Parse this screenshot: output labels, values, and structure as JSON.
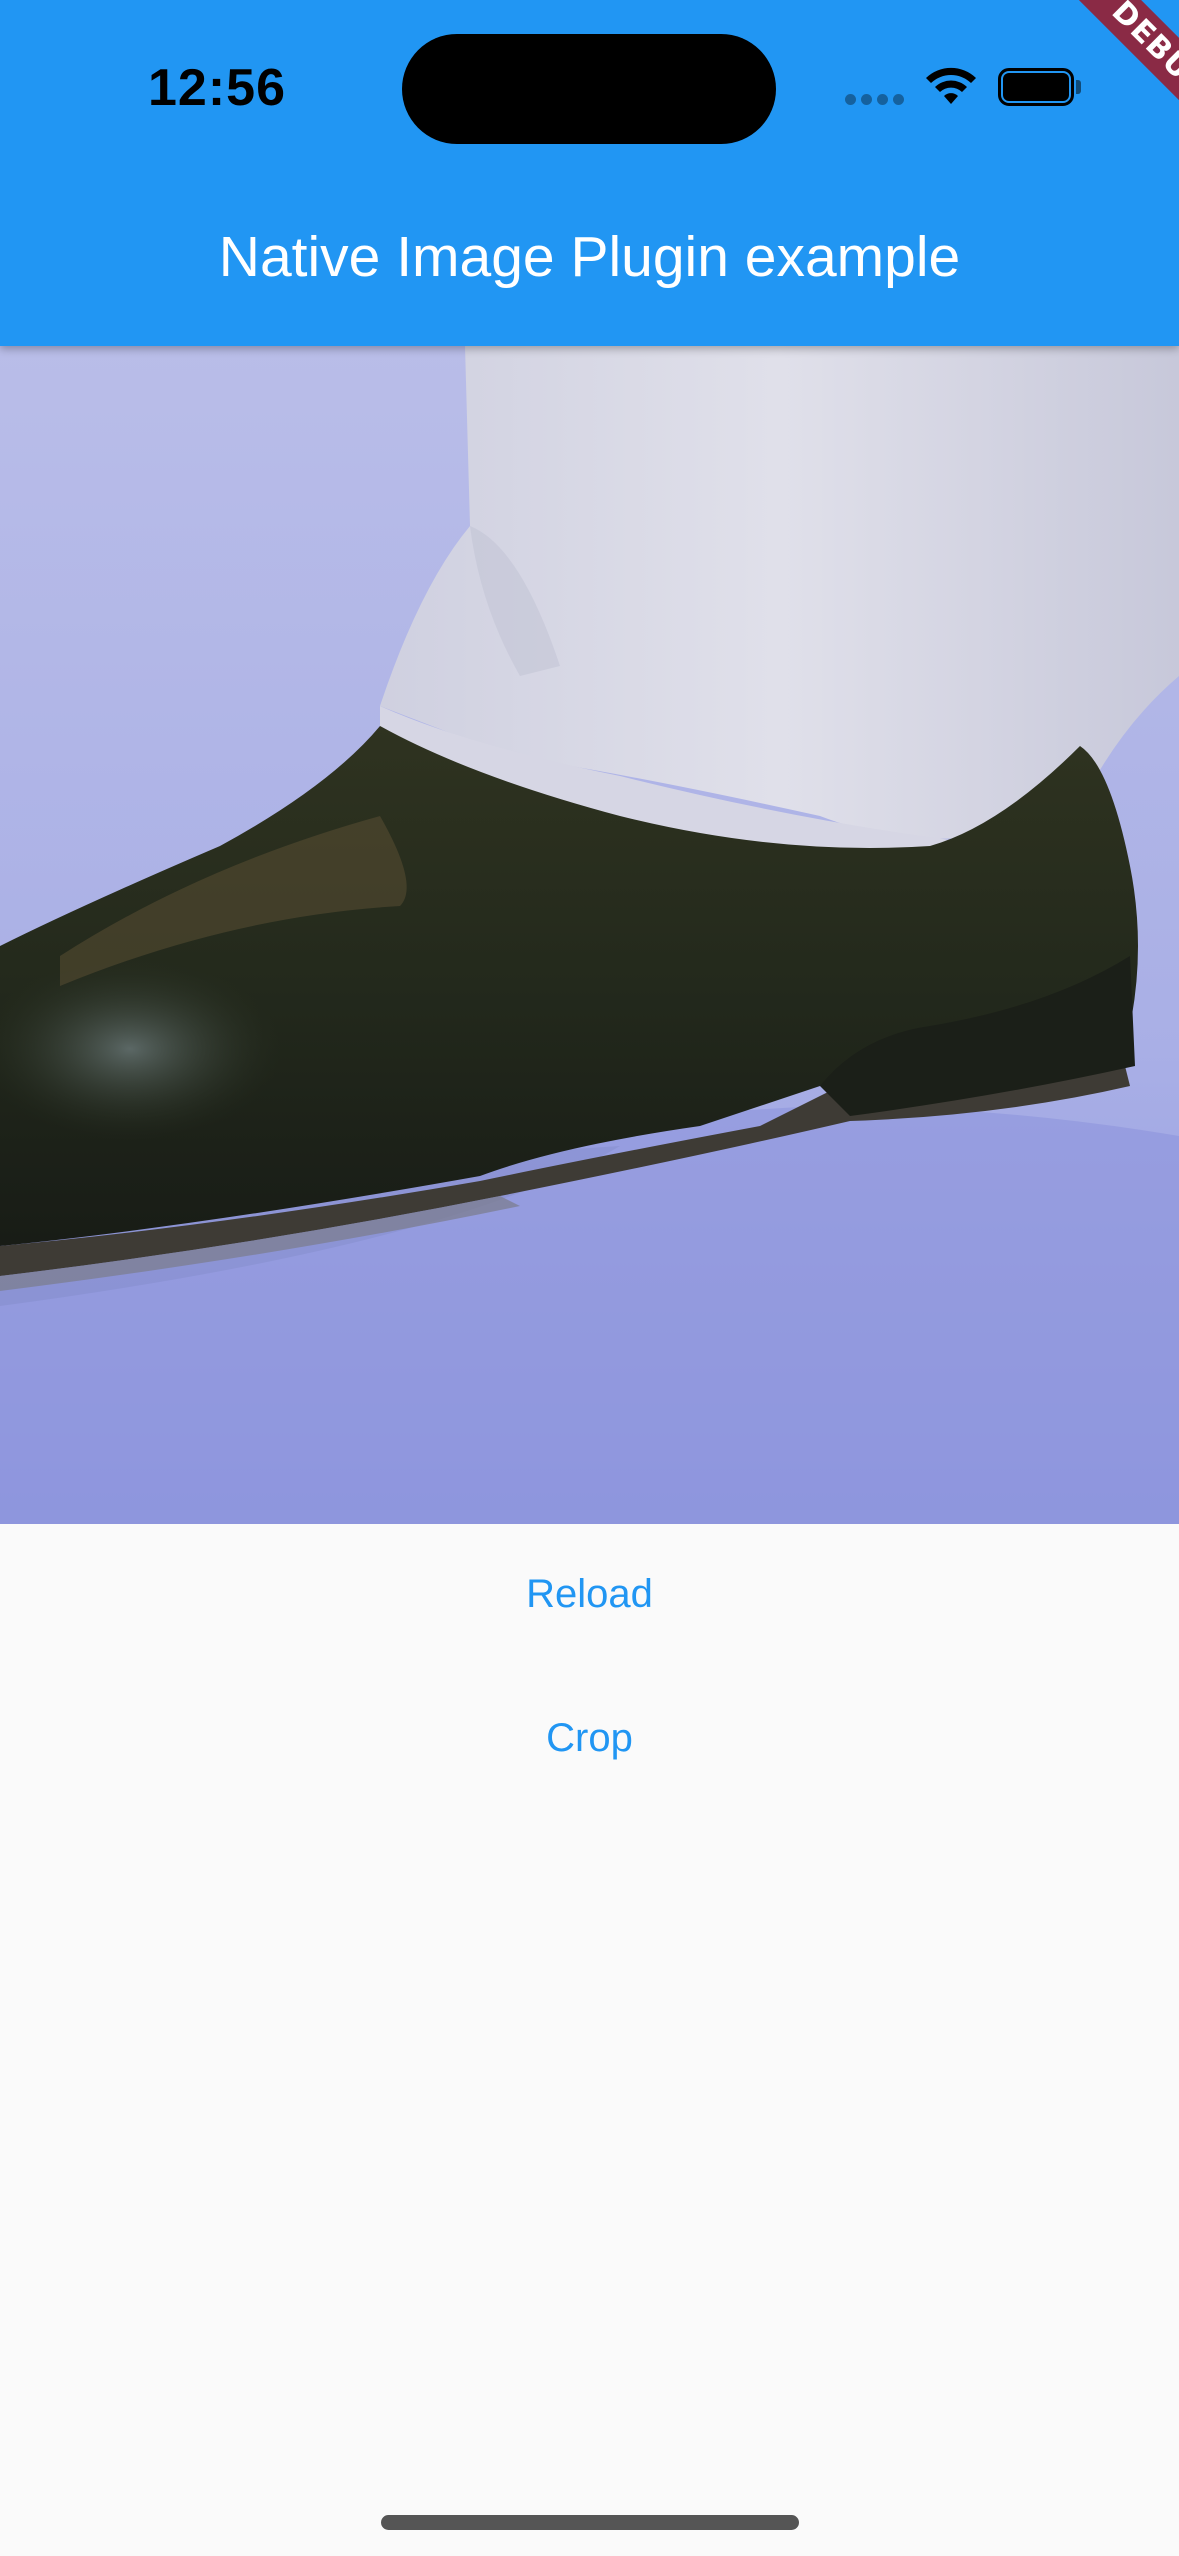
{
  "status_bar": {
    "time": "12:56",
    "icons": [
      "cellular-signal-icon",
      "wifi-icon",
      "battery-icon"
    ]
  },
  "app_bar": {
    "title": "Native Image Plugin example",
    "color": "#2196f3"
  },
  "debug_banner": {
    "label": "DEBUG",
    "color": "#8a2a45"
  },
  "image": {
    "subject": "photo of a black leather shoe and light trouser cuff"
  },
  "buttons": {
    "reload_label": "Reload",
    "crop_label": "Crop",
    "color": "#2196f3"
  }
}
